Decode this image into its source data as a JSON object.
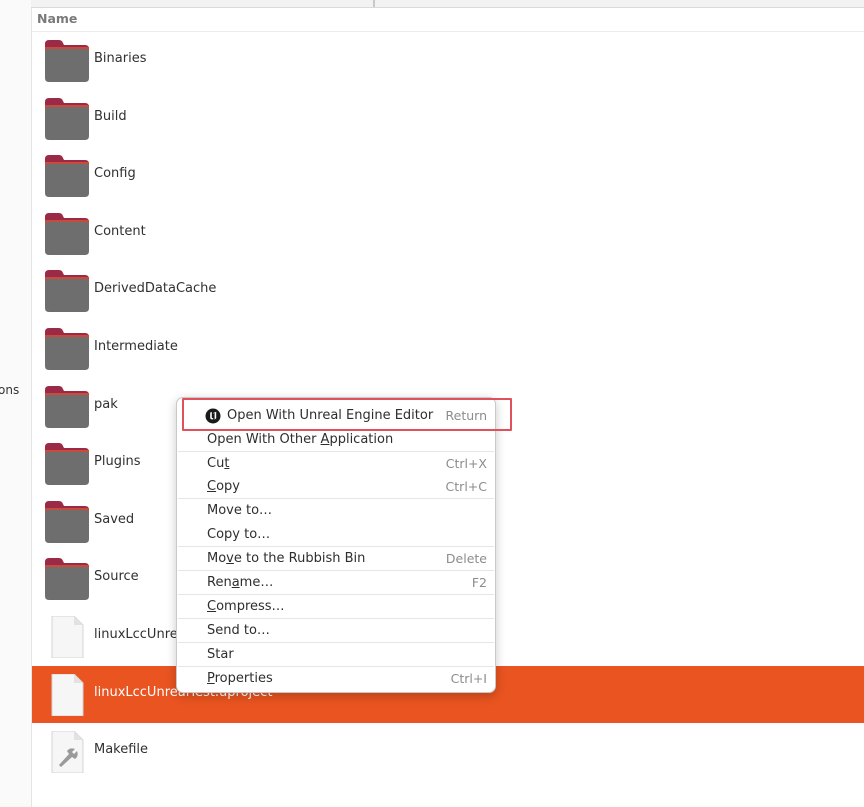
{
  "sidebar": {
    "partial_label": "ons"
  },
  "file_list": {
    "column_header": "Name",
    "items": [
      {
        "name": "Binaries",
        "kind": "folder"
      },
      {
        "name": "Build",
        "kind": "folder"
      },
      {
        "name": "Config",
        "kind": "folder"
      },
      {
        "name": "Content",
        "kind": "folder"
      },
      {
        "name": "DerivedDataCache",
        "kind": "folder"
      },
      {
        "name": "Intermediate",
        "kind": "folder"
      },
      {
        "name": "pak",
        "kind": "folder"
      },
      {
        "name": "Plugins",
        "kind": "folder"
      },
      {
        "name": "Saved",
        "kind": "folder"
      },
      {
        "name": "Source",
        "kind": "folder"
      },
      {
        "name": "linuxLccUnrea",
        "kind": "file"
      },
      {
        "name": "linuxLccUnrealTest.uproject",
        "kind": "file",
        "selected": true
      },
      {
        "name": "Makefile",
        "kind": "script"
      }
    ]
  },
  "context_menu": {
    "open_with_ue": {
      "label": "Open With Unreal Engine Editor",
      "shortcut": "Return",
      "icon": "unreal-engine-icon"
    },
    "open_with_other": {
      "pre": "Open With Other ",
      "key": "A",
      "post": "pplication"
    },
    "cut": {
      "pre": "Cu",
      "key": "t",
      "post": "",
      "shortcut": "Ctrl+X"
    },
    "copy": {
      "pre": "",
      "key": "C",
      "post": "opy",
      "shortcut": "Ctrl+C"
    },
    "move_to": {
      "label": "Move to…"
    },
    "copy_to": {
      "label": "Copy to…"
    },
    "rubbish": {
      "pre": "Mo",
      "key": "v",
      "post": "e to the Rubbish Bin",
      "shortcut": "Delete"
    },
    "rename": {
      "pre": "Ren",
      "key": "a",
      "post": "me…",
      "shortcut": "F2"
    },
    "compress": {
      "pre": "",
      "key": "C",
      "post": "ompress…"
    },
    "send_to": {
      "label": "Send to…"
    },
    "star": {
      "label": "Star"
    },
    "properties": {
      "pre": "",
      "key": "P",
      "post": "roperties",
      "shortcut": "Ctrl+I"
    }
  },
  "colors": {
    "selection": "#e95420",
    "folder_body": "#6e6e6e",
    "folder_tab": "#9b2a46",
    "highlight_box": "#e0505d"
  }
}
